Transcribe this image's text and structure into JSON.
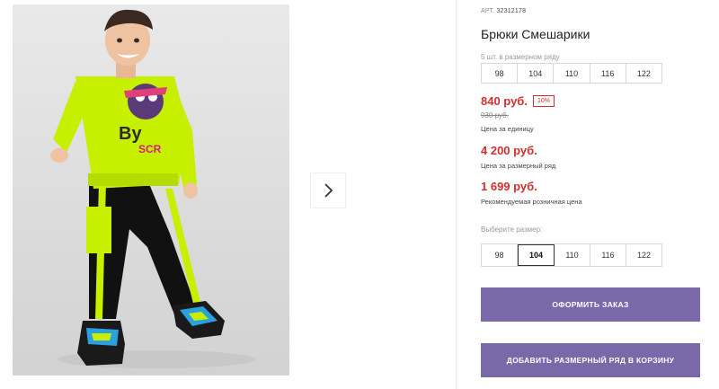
{
  "product": {
    "sku_label": "АРТ.",
    "sku": "32312178",
    "title": "Брюки Смешарики"
  },
  "size_range": {
    "note": "5 шт. в размерном ряду",
    "sizes": [
      "98",
      "104",
      "110",
      "116",
      "122"
    ]
  },
  "pricing": {
    "price": "840 руб.",
    "discount": "10%",
    "old_price": "930 руб.",
    "unit_caption": "Цена за единицу",
    "range_price": "4 200 руб.",
    "range_caption": "Цена за размерный ряд",
    "retail_price": "1 699 руб.",
    "retail_caption": "Рекомендуемая розничная цена"
  },
  "size_select": {
    "label": "Выберите размер:",
    "options": [
      "98",
      "104",
      "110",
      "116",
      "122"
    ],
    "selected": "104"
  },
  "actions": {
    "order_label": "ОФОРМИТЬ ЗАКАЗ",
    "add_range_label": "ДОБАВИТЬ РАЗМЕРНЫЙ РЯД В КОРЗИНУ"
  },
  "gallery": {
    "next_icon": "chevron-right-icon"
  },
  "colors": {
    "accent": "#7b68a8",
    "price_red": "#d32f2f"
  }
}
